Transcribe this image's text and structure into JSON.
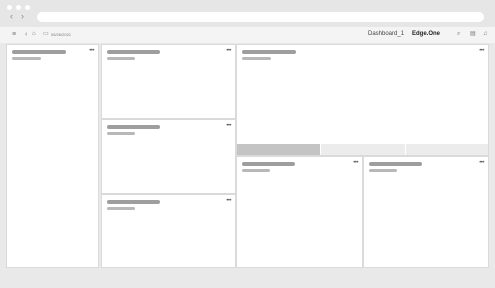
{
  "toolbar": {
    "menu_icon": "menu-icon",
    "back_icon": "chevron-left-icon",
    "home_icon": "home-icon",
    "calendar_icon": "calendar-icon",
    "date_text": "05/26/2021",
    "dashboard_name": "Dashboard_1",
    "workspace_name": "Edge.One",
    "search_icon": "search-icon",
    "layout_icon": "layout-icon",
    "bell_icon": "bell-icon"
  },
  "panels": {
    "more_label": "•••"
  },
  "colors": {
    "background": "#e9e9e9",
    "panel": "#ffffff",
    "placeholder_dark": "#9e9e9e",
    "placeholder_light": "#b8b8b8",
    "tab_active": "#c4c4c4",
    "tab_inactive": "#ececec"
  }
}
